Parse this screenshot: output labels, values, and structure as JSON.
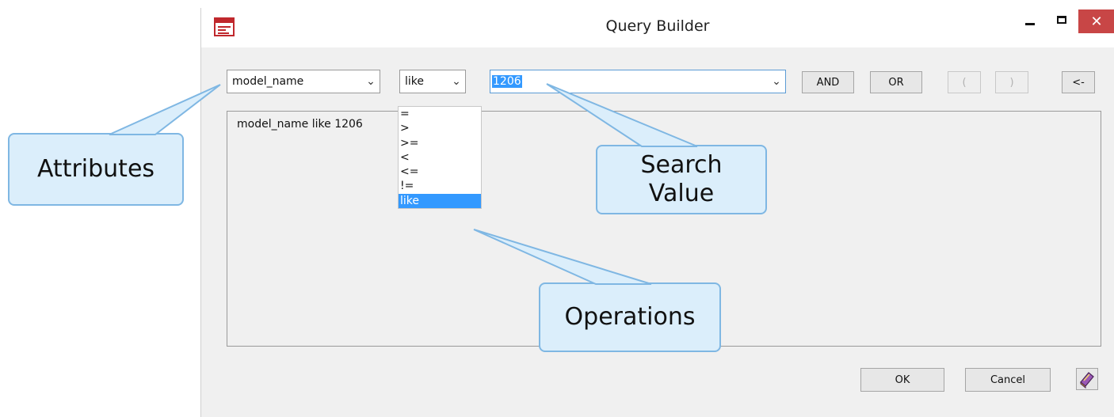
{
  "window": {
    "title": "Query Builder",
    "close_glyph": "✕"
  },
  "toolbar": {
    "attribute_value": "model_name",
    "operator_value": "like",
    "search_value": "1206",
    "and_label": "AND",
    "or_label": "OR",
    "open_paren_label": "(",
    "close_paren_label": ")",
    "backspace_label": "<-"
  },
  "operator_options": [
    "=",
    ">",
    ">=",
    "<",
    "<=",
    "!=",
    "like"
  ],
  "query_text": "model_name like 1206",
  "footer": {
    "ok_label": "OK",
    "cancel_label": "Cancel"
  },
  "callouts": {
    "attributes": "Attributes",
    "search_line1": "Search",
    "search_line2": "Value",
    "operations": "Operations"
  },
  "icons": {
    "app": "query-builder-app-icon",
    "dropdown": "chevron-down-icon",
    "help": "help-book-icon"
  },
  "colors": {
    "selection": "#3399ff",
    "callout_fill": "#dbeefb",
    "callout_border": "#7fb7e3",
    "close_button": "#c84646"
  }
}
